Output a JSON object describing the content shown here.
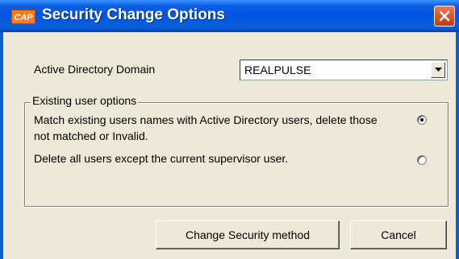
{
  "window": {
    "app_icon_text": "CAP",
    "title": "Security Change Options"
  },
  "domain": {
    "label": "Active Directory Domain",
    "value": "REALPULSE"
  },
  "group": {
    "legend": "Existing user options",
    "options": [
      {
        "label": "Match existing users names with Active Directory users, delete those not matched or Invalid.",
        "selected": true
      },
      {
        "label": "Delete all users except the current supervisor user.",
        "selected": false
      }
    ]
  },
  "buttons": {
    "change_label": "Change Security method",
    "cancel_label": "Cancel"
  }
}
